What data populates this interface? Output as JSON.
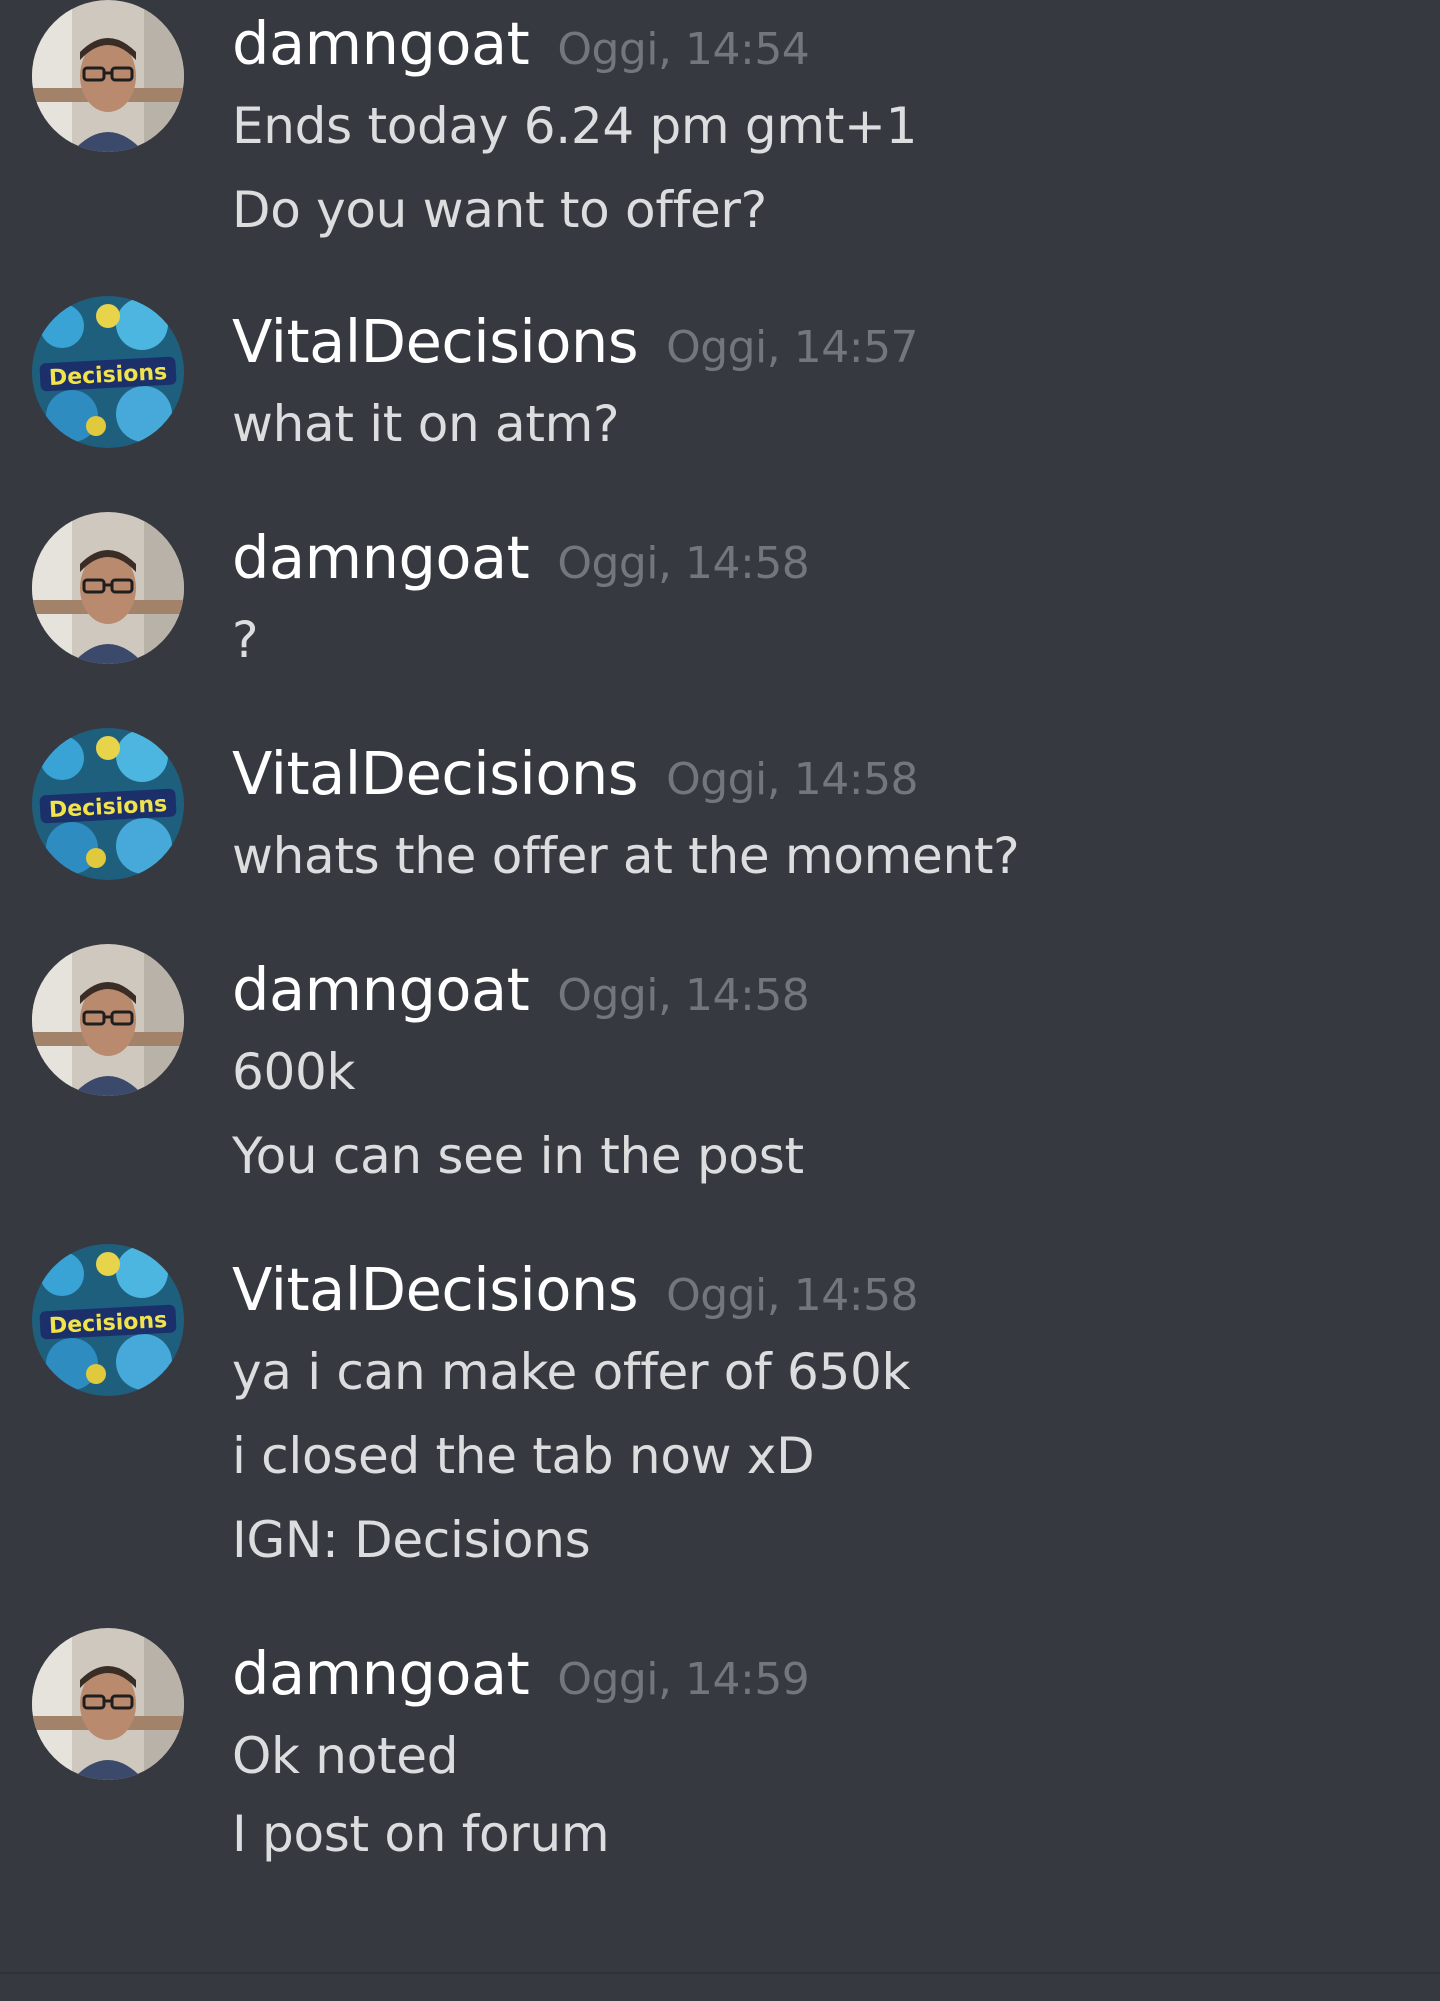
{
  "conversation": {
    "messages": [
      {
        "username": "damngoat",
        "timestamp": "Oggi, 14:54",
        "avatar": "face-photo-avatar",
        "lines": [
          "Ends today 6.24 pm gmt+1",
          "Do you want to offer?"
        ]
      },
      {
        "username": "VitalDecisions",
        "timestamp": "Oggi, 14:57",
        "avatar": "decisions-logo-avatar",
        "avatar_text": "Decisions",
        "lines": [
          "what it on atm?"
        ]
      },
      {
        "username": "damngoat",
        "timestamp": "Oggi, 14:58",
        "avatar": "face-photo-avatar",
        "lines": [
          "?"
        ]
      },
      {
        "username": "VitalDecisions",
        "timestamp": "Oggi, 14:58",
        "avatar": "decisions-logo-avatar",
        "avatar_text": "Decisions",
        "lines": [
          "whats the offer at the moment?"
        ]
      },
      {
        "username": "damngoat",
        "timestamp": "Oggi, 14:58",
        "avatar": "face-photo-avatar",
        "lines": [
          "600k",
          "You can see in the post"
        ]
      },
      {
        "username": "VitalDecisions",
        "timestamp": "Oggi, 14:58",
        "avatar": "decisions-logo-avatar",
        "avatar_text": "Decisions",
        "lines": [
          "ya i can make offer of 650k",
          "i closed the tab now xD",
          "IGN: Decisions"
        ]
      },
      {
        "username": "damngoat",
        "timestamp": "Oggi, 14:59",
        "avatar": "face-photo-avatar",
        "lines": [
          "Ok noted",
          "I post on forum"
        ]
      }
    ]
  },
  "colors": {
    "background": "#36393f",
    "username": "#ffffff",
    "timestamp": "#72767d",
    "message_text": "#dcddde"
  }
}
